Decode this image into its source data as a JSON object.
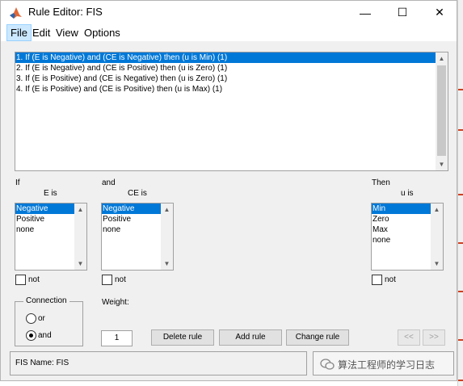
{
  "window": {
    "title": "Rule Editor: FIS",
    "minimize": "—",
    "maximize": "☐",
    "close": "✕"
  },
  "menu": [
    {
      "label": "File",
      "active": true
    },
    {
      "label": "Edit"
    },
    {
      "label": "View"
    },
    {
      "label": "Options"
    }
  ],
  "rules": [
    "1. If (E is Negative) and (CE is Negative) then (u is Min) (1)",
    "2. If (E is Negative) and (CE is Positive) then (u is Zero) (1)",
    "3. If (E is Positive) and (CE is Negative) then (u is Zero) (1)",
    "4. If (E is Positive) and (CE is Positive) then (u is Max) (1)"
  ],
  "selected_rule_index": 0,
  "inputs": {
    "if_label": "If",
    "e_label": "E is",
    "e_options": [
      "Negative",
      "Positive",
      "none"
    ],
    "and_label": "and",
    "ce_label": "CE is",
    "ce_options": [
      "Negative",
      "Positive",
      "none"
    ]
  },
  "output": {
    "then_label": "Then",
    "u_label": "u is",
    "u_options": [
      "Min",
      "Zero",
      "Max",
      "none"
    ]
  },
  "not_label": "not",
  "connection": {
    "legend": "Connection",
    "or_label": "or",
    "and_label": "and",
    "selected": "and"
  },
  "weight": {
    "label": "Weight:",
    "value": "1"
  },
  "buttons": {
    "delete": "Delete rule",
    "add": "Add rule",
    "change": "Change rule",
    "prev": "<<",
    "next": ">>"
  },
  "status": {
    "fis_name": "FIS Name: FIS"
  },
  "watermark": "算法工程师的学习日志"
}
